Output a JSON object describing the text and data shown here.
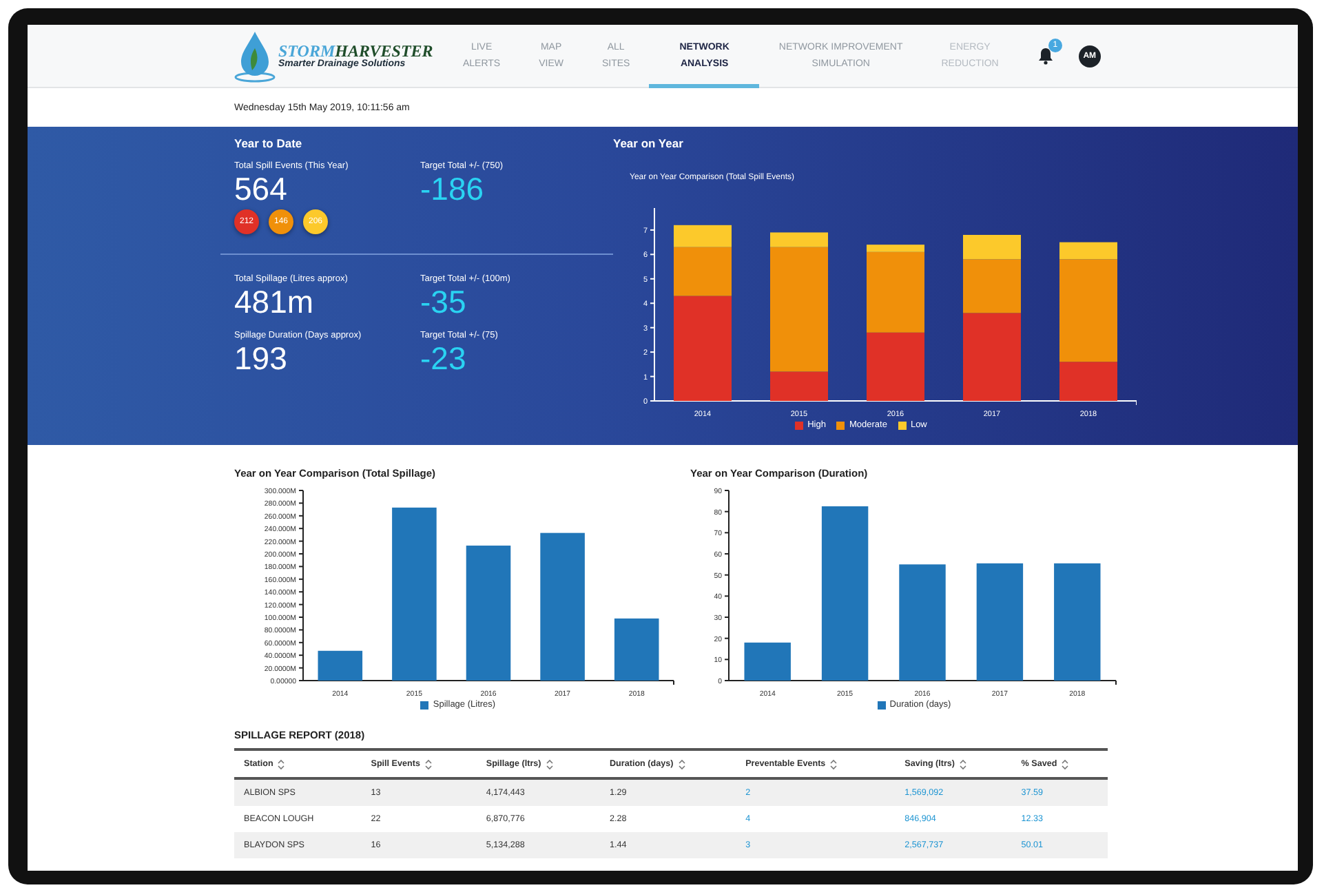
{
  "nav": {
    "logo": {
      "word_1": "STORM",
      "word_2": "HARVESTER",
      "tagline": "Smarter Drainage Solutions"
    },
    "items": [
      {
        "lines": [
          "LIVE",
          "ALERTS"
        ],
        "selected": false,
        "disabled": false
      },
      {
        "lines": [
          "MAP",
          "VIEW"
        ],
        "selected": false,
        "disabled": false
      },
      {
        "lines": [
          "ALL",
          "SITES"
        ],
        "selected": false,
        "disabled": false
      },
      {
        "lines": [
          "NETWORK",
          "ANALYSIS"
        ],
        "selected": true,
        "disabled": false
      },
      {
        "lines": [
          "NETWORK IMPROVEMENT",
          "SIMULATION"
        ],
        "selected": false,
        "disabled": false
      },
      {
        "lines": [
          "ENERGY",
          "REDUCTION"
        ],
        "selected": false,
        "disabled": true
      }
    ],
    "notification_count": "1",
    "avatar": "AM"
  },
  "date_time": "Wednesday 15th May 2019, 10:11:56 am",
  "year_to_date": {
    "heading": "Year to Date",
    "stats": [
      {
        "label": "Total Spill Events (This Year)",
        "value": "564",
        "target_label": "Target Total +/- (750)",
        "target_value": "-186",
        "counts": [
          {
            "value": "212",
            "color": "#e03127"
          },
          {
            "value": "146",
            "color": "#f0900a"
          },
          {
            "value": "206",
            "color": "#fcc92b"
          }
        ]
      },
      {
        "label": "Total Spillage (Litres approx)",
        "value": "481m",
        "target_label": "Target Total +/- (100m)",
        "target_value": "-35"
      },
      {
        "label": "Spillage Duration (Days approx)",
        "value": "193",
        "target_label": "Target Total +/- (75)",
        "target_value": "-23"
      }
    ]
  },
  "year_on_year": {
    "heading": "Year on Year",
    "chart_data": {
      "type": "bar",
      "stacked": true,
      "title": "Year on Year Comparison (Total Spill Events)",
      "categories": [
        "2014",
        "2015",
        "2016",
        "2017",
        "2018"
      ],
      "ylim": [
        0,
        7.9
      ],
      "yticks": [
        0,
        1,
        2,
        3,
        4,
        5,
        6,
        7
      ],
      "series": [
        {
          "name": "High",
          "color": "#e03127",
          "values": [
            4.3,
            1.2,
            2.8,
            3.6,
            1.6
          ]
        },
        {
          "name": "Moderate",
          "color": "#f0900a",
          "values": [
            2.0,
            5.1,
            3.3,
            2.2,
            4.2
          ]
        },
        {
          "name": "Low",
          "color": "#fcc92b",
          "values": [
            0.9,
            0.6,
            0.3,
            1.0,
            0.7
          ]
        }
      ]
    }
  },
  "charts": [
    {
      "chart_data": {
        "type": "bar",
        "title": "Year on Year Comparison (Total Spillage)",
        "categories": [
          "2014",
          "2015",
          "2016",
          "2017",
          "2018"
        ],
        "ylim": [
          0,
          300000000
        ],
        "yticks": [
          {
            "value": 0,
            "label": "0.00000"
          },
          {
            "value": 20000000,
            "label": "20.0000M"
          },
          {
            "value": 40000000,
            "label": "40.0000M"
          },
          {
            "value": 60000000,
            "label": "60.0000M"
          },
          {
            "value": 80000000,
            "label": "80.0000M"
          },
          {
            "value": 100000000,
            "label": "100.000M"
          },
          {
            "value": 120000000,
            "label": "120.000M"
          },
          {
            "value": 140000000,
            "label": "140.000M"
          },
          {
            "value": 160000000,
            "label": "160.000M"
          },
          {
            "value": 180000000,
            "label": "180.000M"
          },
          {
            "value": 200000000,
            "label": "200.000M"
          },
          {
            "value": 220000000,
            "label": "220.000M"
          },
          {
            "value": 240000000,
            "label": "240.000M"
          },
          {
            "value": 260000000,
            "label": "260.000M"
          },
          {
            "value": 280000000,
            "label": "280.000M"
          },
          {
            "value": 300000000,
            "label": "300.000M"
          }
        ],
        "series": [
          {
            "name": "Spillage (Litres)",
            "color": "#2176b8",
            "values": [
              47000000,
              273000000,
              213000000,
              233000000,
              98000000
            ]
          }
        ]
      }
    },
    {
      "chart_data": {
        "type": "bar",
        "title": "Year on Year Comparison (Duration)",
        "categories": [
          "2014",
          "2015",
          "2016",
          "2017",
          "2018"
        ],
        "ylim": [
          0,
          90
        ],
        "yticks": [
          0,
          10,
          20,
          30,
          40,
          50,
          60,
          70,
          80,
          90
        ],
        "series": [
          {
            "name": "Duration (days)",
            "color": "#2176b8",
            "values": [
              18,
              82.5,
              55,
              55.5,
              55.5
            ]
          }
        ]
      }
    }
  ],
  "spillage_report": {
    "title": "SPILLAGE REPORT (2018)",
    "columns": [
      {
        "label": "Station",
        "link": false
      },
      {
        "label": "Spill Events",
        "link": false
      },
      {
        "label": "Spillage (ltrs)",
        "link": false
      },
      {
        "label": "Duration (days)",
        "link": false
      },
      {
        "label": "Preventable Events",
        "link": true
      },
      {
        "label": "Saving (ltrs)",
        "link": true
      },
      {
        "label": "% Saved",
        "link": true
      }
    ],
    "rows": [
      [
        "ALBION SPS",
        "13",
        "4,174,443",
        "1.29",
        "2",
        "1,569,092",
        "37.59"
      ],
      [
        "BEACON LOUGH",
        "22",
        "6,870,776",
        "2.28",
        "4",
        "846,904",
        "12.33"
      ],
      [
        "BLAYDON SPS",
        "16",
        "5,134,288",
        "1.44",
        "3",
        "2,567,737",
        "50.01"
      ]
    ]
  }
}
